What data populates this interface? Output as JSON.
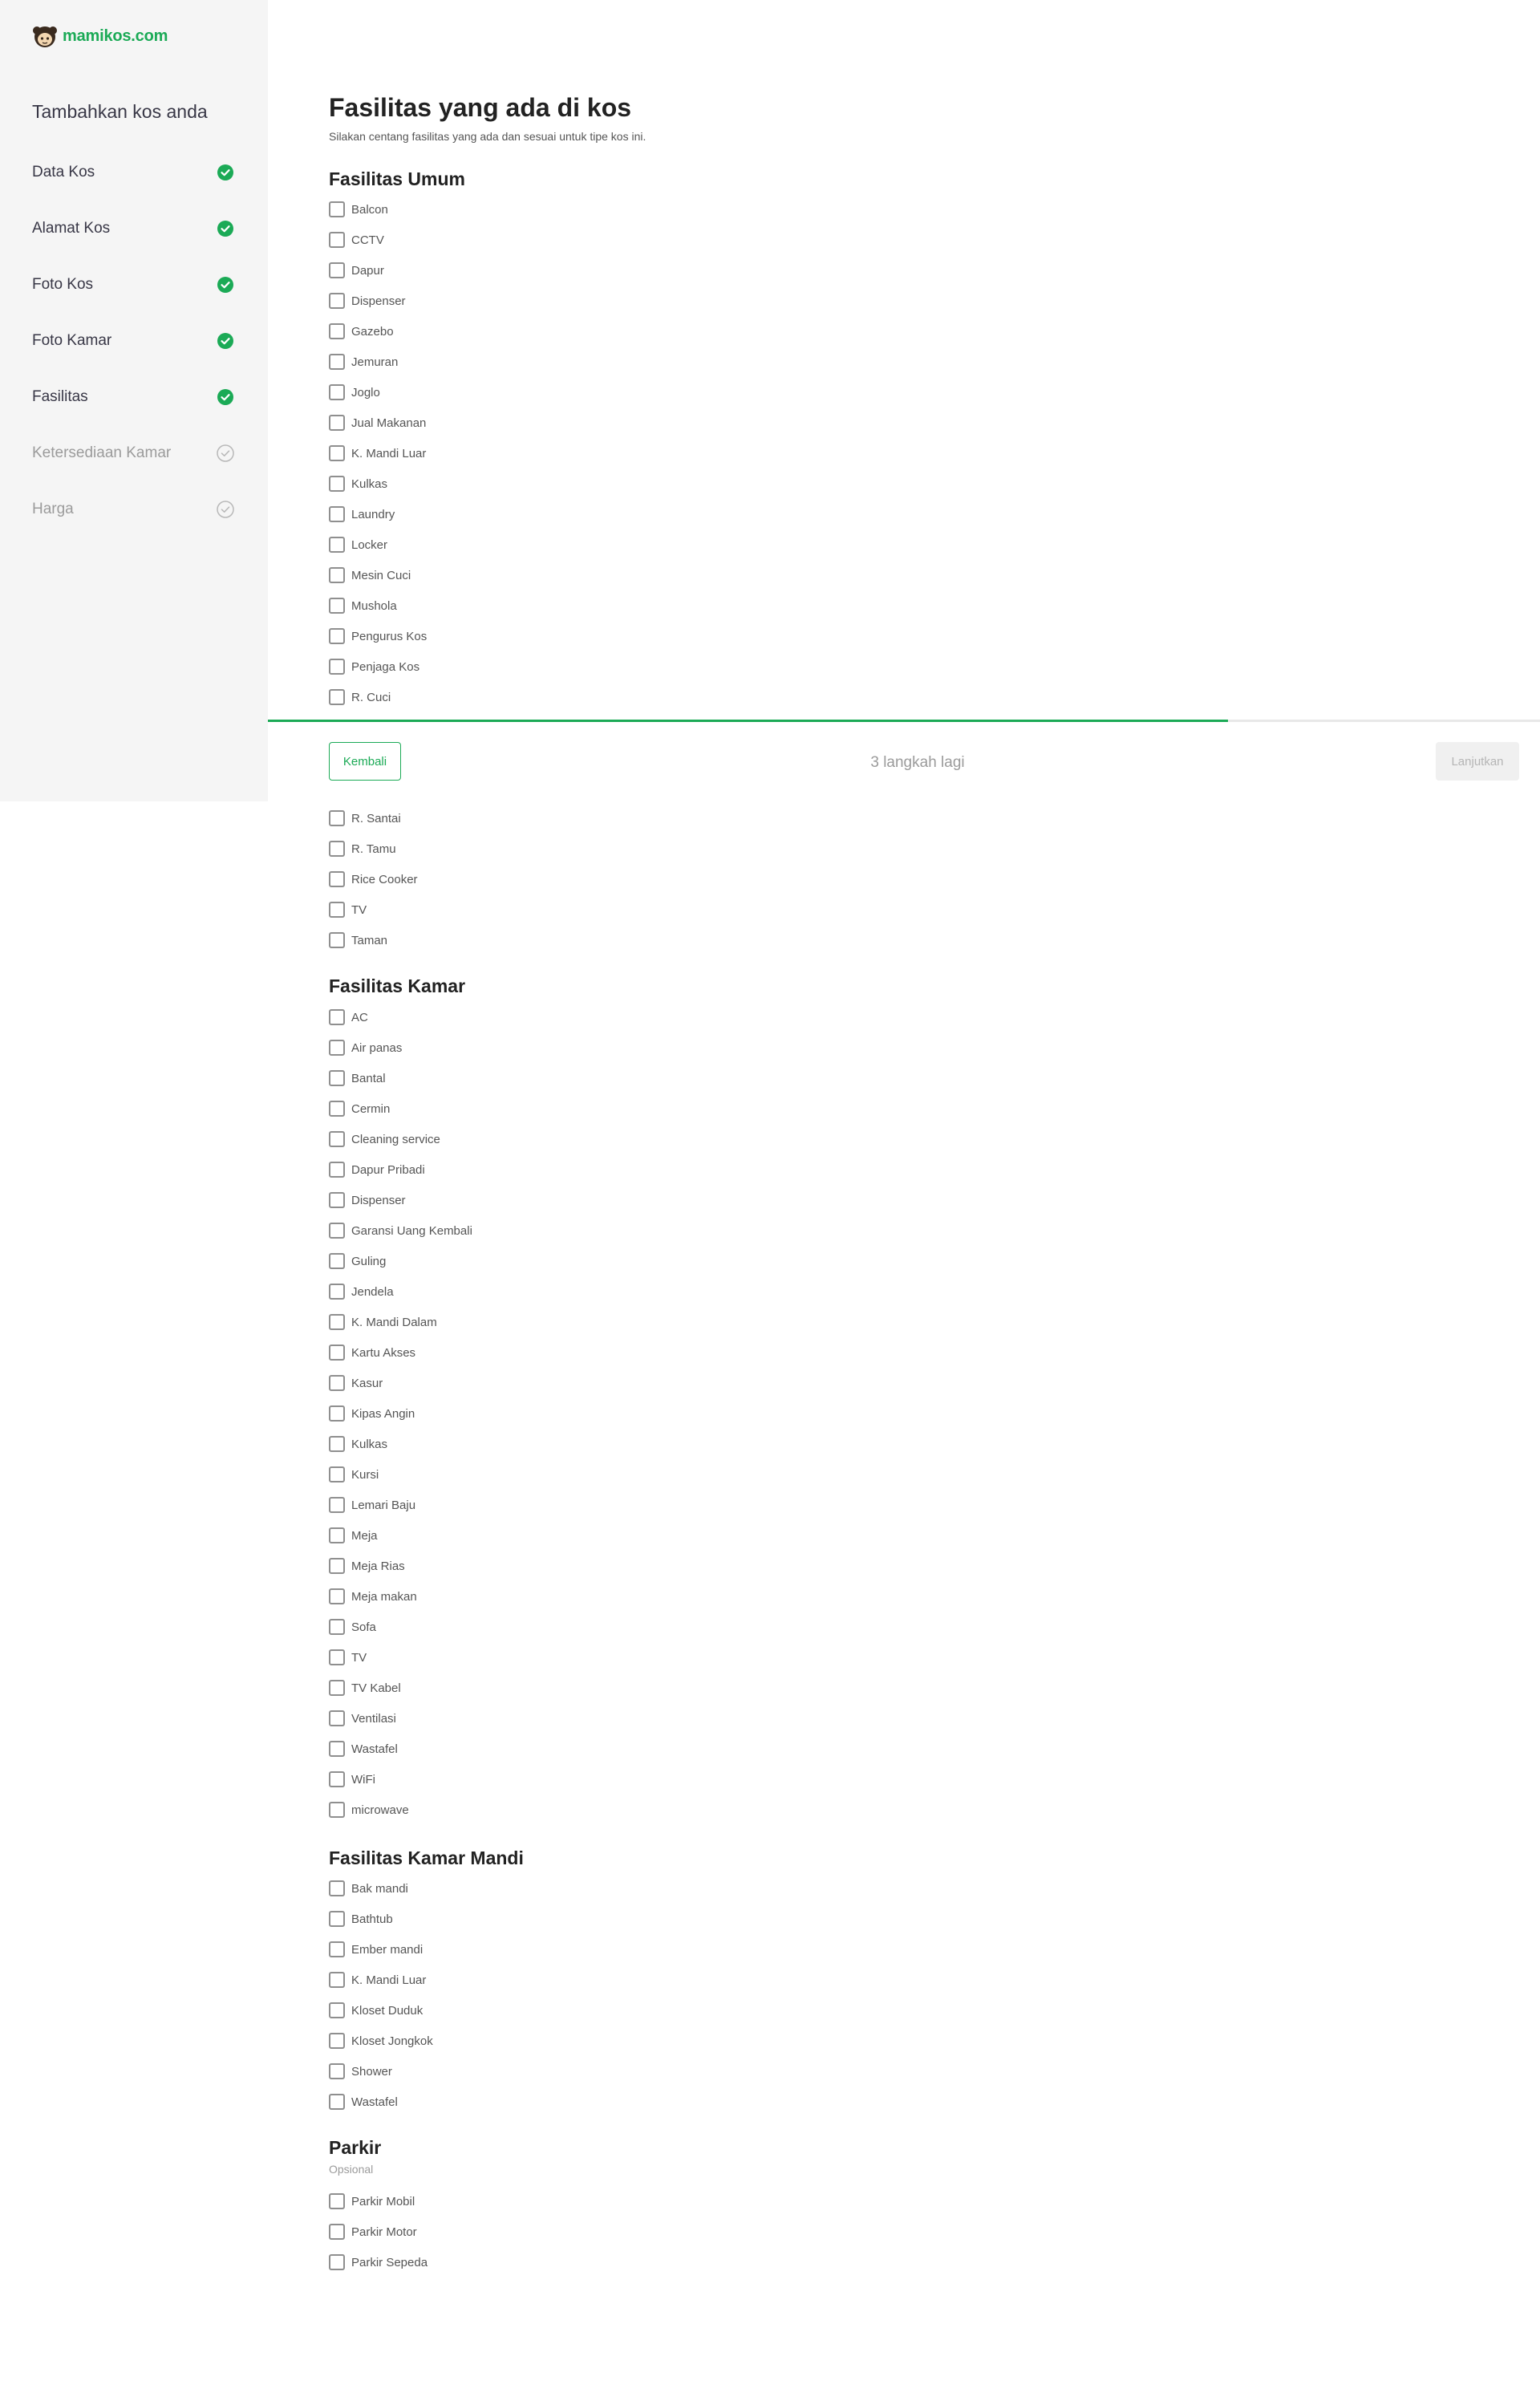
{
  "brand": {
    "name": "mamikos.com",
    "accent": "#1BAA56"
  },
  "sidebar": {
    "title": "Tambahkan kos anda",
    "steps": [
      {
        "label": "Data Kos",
        "status": "done"
      },
      {
        "label": "Alamat Kos",
        "status": "done"
      },
      {
        "label": "Foto Kos",
        "status": "done"
      },
      {
        "label": "Foto Kamar",
        "status": "done"
      },
      {
        "label": "Fasilitas",
        "status": "done"
      },
      {
        "label": "Ketersediaan Kamar",
        "status": "pending"
      },
      {
        "label": "Harga",
        "status": "pending"
      }
    ]
  },
  "page": {
    "title": "Fasilitas yang ada di kos",
    "subtitle": "Silakan centang fasilitas yang ada dan sesuai untuk tipe kos ini."
  },
  "sections": {
    "umum": {
      "heading": "Fasilitas Umum",
      "items_top": [
        "Balcon",
        "CCTV",
        "Dapur",
        "Dispenser",
        "Gazebo",
        "Jemuran",
        "Joglo",
        "Jual Makanan",
        "K. Mandi Luar",
        "Kulkas",
        "Laundry",
        "Locker",
        "Mesin Cuci",
        "Mushola",
        "Pengurus Kos",
        "Penjaga Kos",
        "R. Cuci"
      ],
      "items_bottom": [
        "R. Santai",
        "R. Tamu",
        "Rice Cooker",
        "TV",
        "Taman"
      ]
    },
    "kamar": {
      "heading": "Fasilitas Kamar",
      "items": [
        "AC",
        "Air panas",
        "Bantal",
        "Cermin",
        "Cleaning service",
        "Dapur Pribadi",
        "Dispenser",
        "Garansi Uang Kembali",
        "Guling",
        "Jendela",
        "K. Mandi Dalam",
        "Kartu Akses",
        "Kasur",
        "Kipas Angin",
        "Kulkas",
        "Kursi",
        "Lemari Baju",
        "Meja",
        "Meja Rias",
        "Meja makan",
        "Sofa",
        "TV",
        "TV Kabel",
        "Ventilasi",
        "Wastafel",
        "WiFi",
        "microwave"
      ]
    },
    "kamar_mandi": {
      "heading": "Fasilitas Kamar Mandi",
      "items": [
        "Bak mandi",
        "Bathtub",
        "Ember mandi",
        "K. Mandi Luar",
        "Kloset Duduk",
        "Kloset Jongkok",
        "Shower",
        "Wastafel"
      ]
    },
    "parkir": {
      "heading": "Parkir",
      "note": "Opsional",
      "items": [
        "Parkir Mobil",
        "Parkir Motor",
        "Parkir Sepeda"
      ]
    }
  },
  "footer": {
    "back_label": "Kembali",
    "steps_left": "3 langkah lagi",
    "next_label": "Lanjutkan",
    "progress": 0.755
  }
}
